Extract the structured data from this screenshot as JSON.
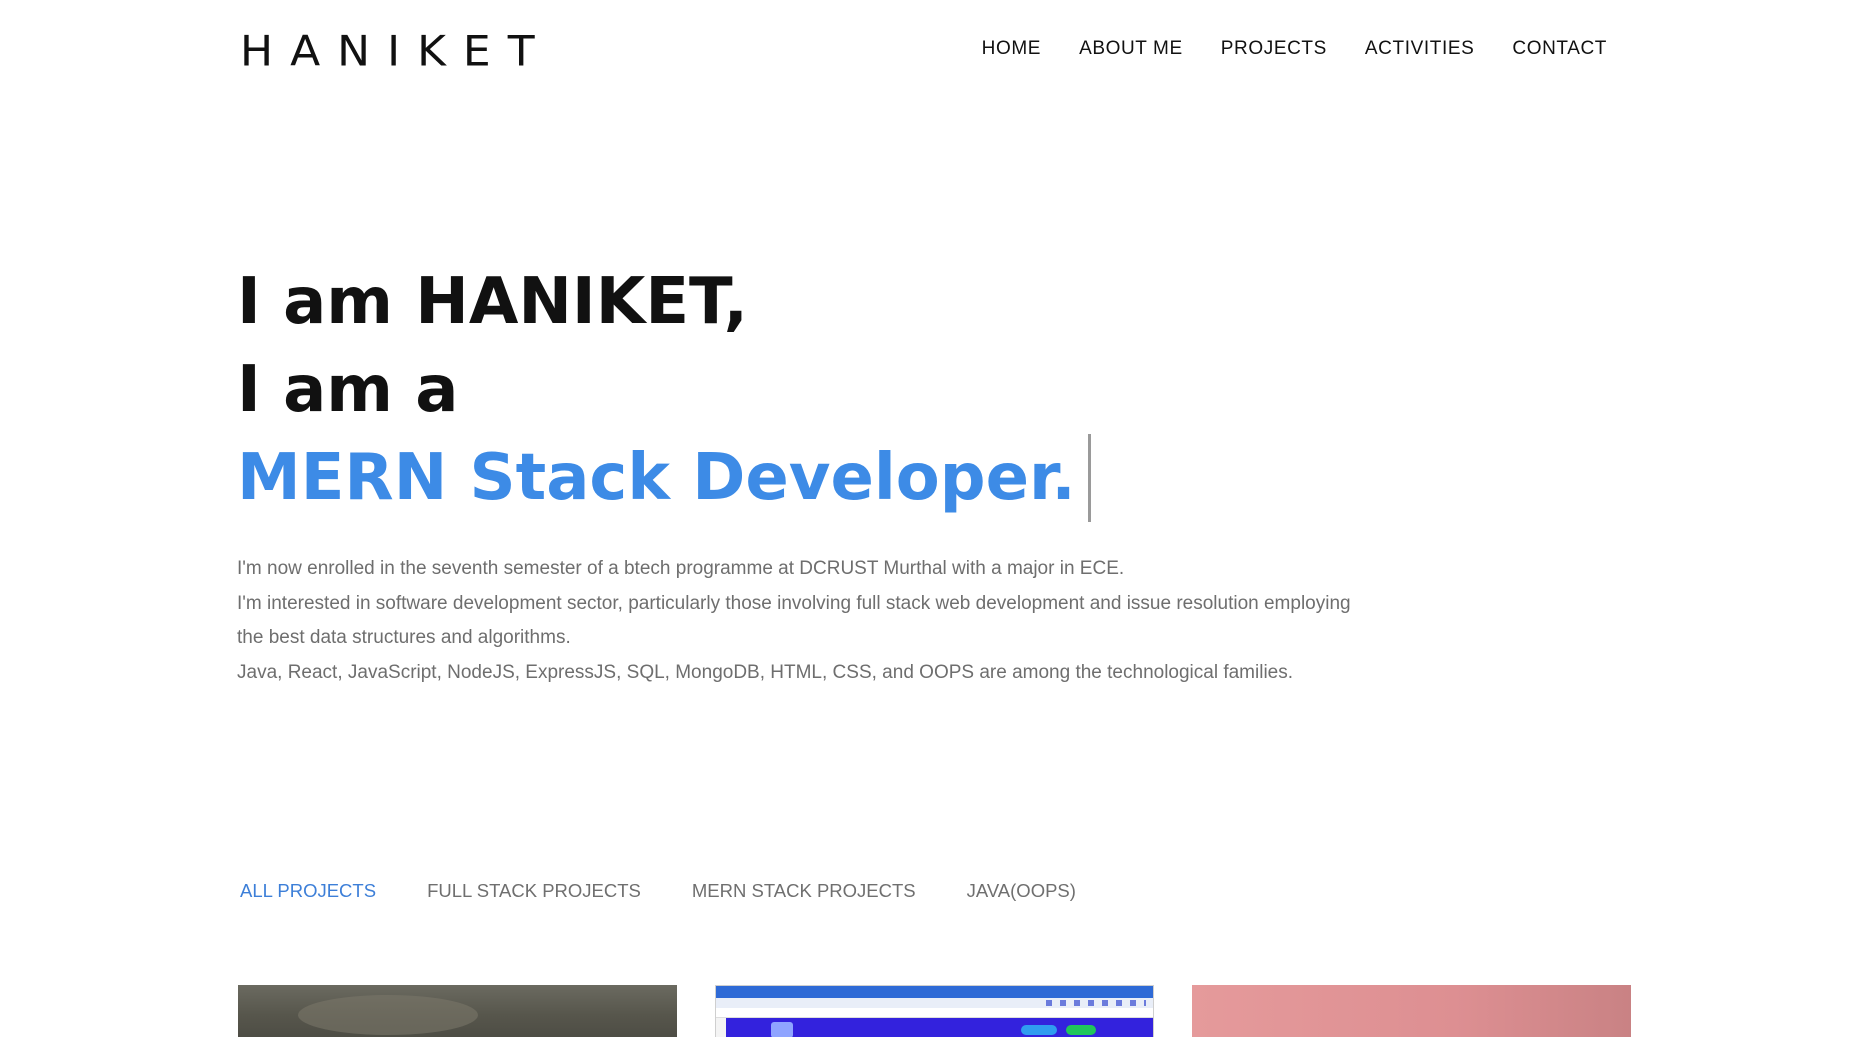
{
  "header": {
    "logo": "HANIKET",
    "nav": [
      "HOME",
      "ABOUT ME",
      "PROJECTS",
      "ACTIVITIES",
      "CONTACT"
    ]
  },
  "hero": {
    "line1": "I am HANIKET,",
    "line2": "I am a",
    "role": "MERN Stack Developer.",
    "role_color": "#3d8be6"
  },
  "about": {
    "p1": "I'm now enrolled in the seventh semester of a btech programme at DCRUST Murthal with a major in ECE.",
    "p2": "I'm interested in software development sector, particularly those involving full stack web development and issue resolution employing the best data structures and algorithms.",
    "p3": "Java, React, JavaScript, NodeJS, ExpressJS, SQL, MongoDB, HTML, CSS, and OOPS are among the technological families."
  },
  "projects": {
    "filters": [
      "ALL PROJECTS",
      "FULL STACK PROJECTS",
      "MERN STACK PROJECTS",
      "JAVA(OOPS)"
    ],
    "active_filter": "ALL PROJECTS",
    "active_color": "#3d7fd8"
  }
}
